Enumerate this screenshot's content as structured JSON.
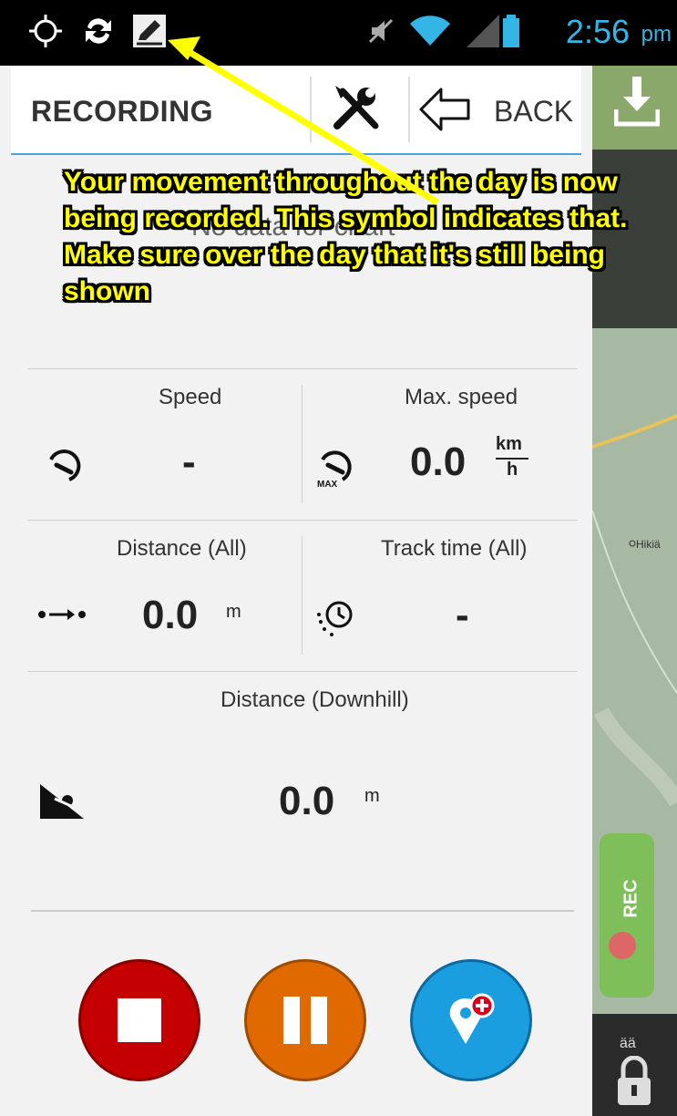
{
  "status_bar": {
    "time": "2:56",
    "ampm": "pm",
    "icons": [
      "crosshair-icon",
      "sync-icon",
      "recording-pen-icon",
      "mute-icon",
      "wifi-icon",
      "signal-icon",
      "battery-icon"
    ]
  },
  "header": {
    "title": "RECORDING",
    "back_label": "BACK"
  },
  "chart": {
    "empty_text": "No data for chart"
  },
  "annotation": {
    "text": "Your movement throughout the day is now being recorded. This symbol indicates that. Make sure over the day that it's still being shown"
  },
  "stats": {
    "speed": {
      "label": "Speed",
      "value": "-"
    },
    "max_speed": {
      "label": "Max. speed",
      "value": "0.0",
      "unit_num": "km",
      "unit_den": "h"
    },
    "distance_all": {
      "label": "Distance (All)",
      "value": "0.0",
      "unit": "m"
    },
    "track_time": {
      "label": "Track time (All)",
      "value": "-"
    },
    "distance_downhill": {
      "label": "Distance (Downhill)",
      "value": "0.0",
      "unit": "m"
    }
  },
  "map": {
    "place_label": "Hikiä",
    "rec_label": "REC",
    "bottom_text": "ää"
  },
  "colors": {
    "stop": "#c40000",
    "pause": "#e06a00",
    "poi": "#1a9ee0",
    "annotation": "#ffff00",
    "time": "#33b5e5"
  }
}
